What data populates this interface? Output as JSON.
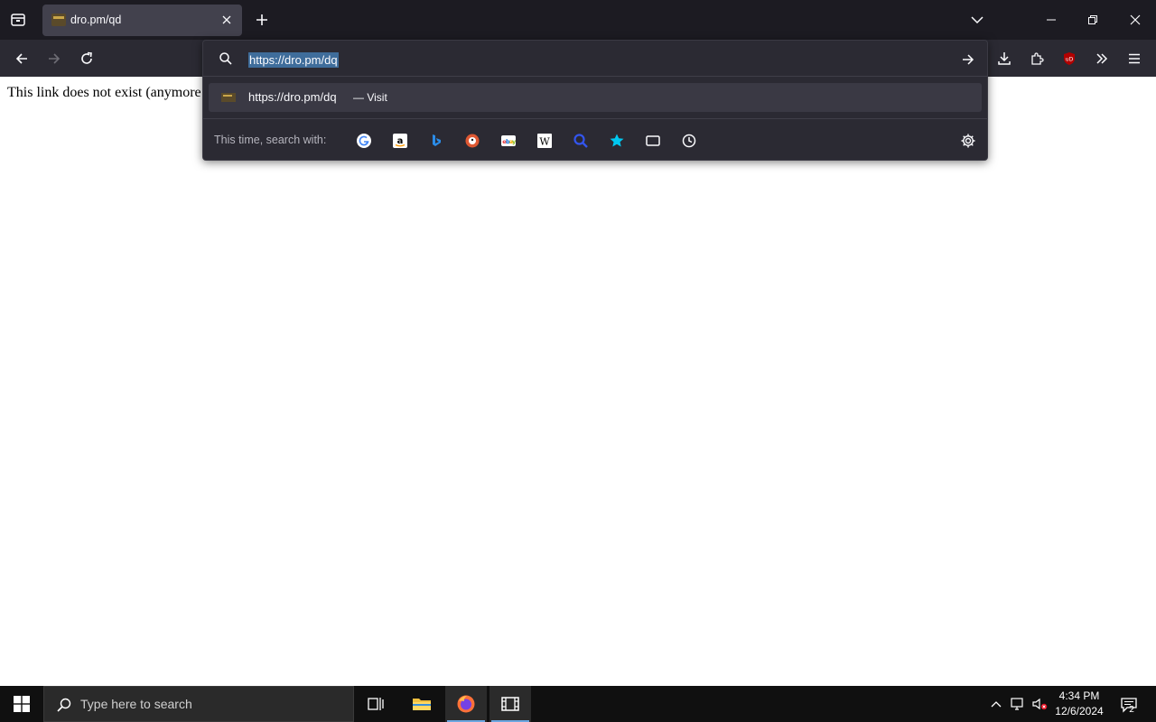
{
  "browser": {
    "tab": {
      "title": "dro.pm/qd"
    },
    "urlbar": {
      "value": "https://dro.pm/dq",
      "suggestion_url": "https://dro.pm/dq",
      "suggestion_action": "— Visit",
      "search_label": "This time, search with:",
      "engines": [
        "google-icon",
        "amazon-icon",
        "bing-icon",
        "duckduckgo-icon",
        "ebay-icon",
        "wikipedia-icon",
        "search-engine-icon",
        "bookmarks-icon",
        "tabs-icon",
        "history-icon"
      ]
    }
  },
  "page": {
    "text": "This link does not exist (anymore"
  },
  "taskbar": {
    "search_placeholder": "Type here to search",
    "time": "4:34 PM",
    "date": "12/6/2024",
    "notification_count": "2"
  },
  "colors": {
    "tabstrip_bg": "#1c1b22",
    "toolbar_bg": "#2b2a33",
    "selection": "#3f6d9b",
    "taskbar_bg": "#101010"
  }
}
